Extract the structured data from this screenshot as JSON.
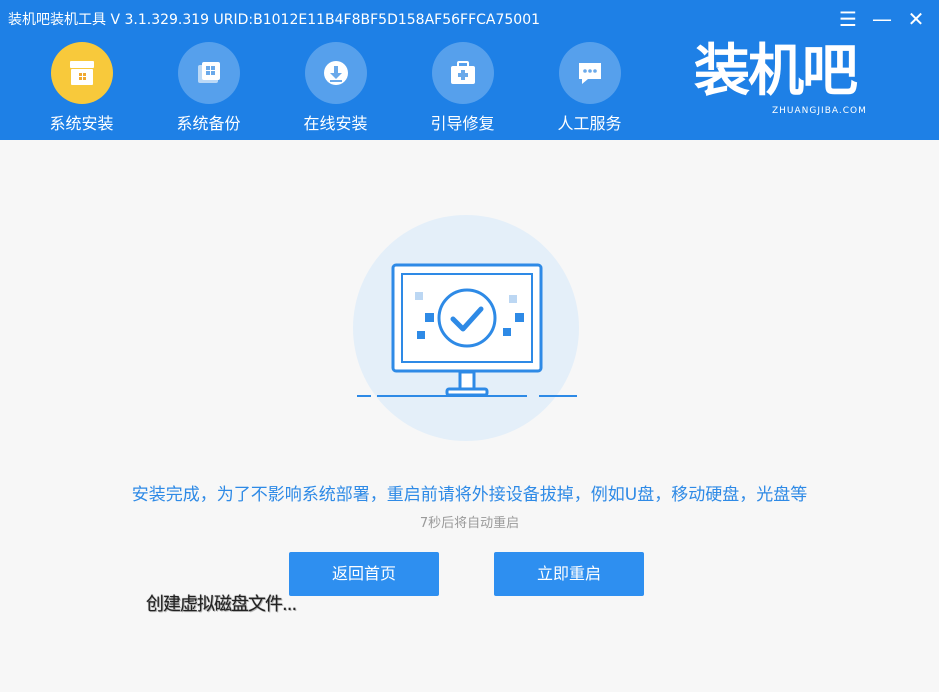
{
  "window": {
    "title": "装机吧装机工具 V 3.1.329.319 URID:B1012E11B4F8BF5D158AF56FFCA75001",
    "menu_glyph": "☰",
    "minimize_glyph": "—",
    "close_glyph": "✕"
  },
  "nav": {
    "items": [
      {
        "label": "系统安装",
        "icon": "system-install-icon",
        "active": true
      },
      {
        "label": "系统备份",
        "icon": "system-backup-icon"
      },
      {
        "label": "在线安装",
        "icon": "online-install-icon"
      },
      {
        "label": "引导修复",
        "icon": "boot-repair-icon"
      },
      {
        "label": "人工服务",
        "icon": "chat-service-icon"
      }
    ]
  },
  "brand": {
    "name_cn": "装机吧",
    "name_en": "ZHUANGJIBA.COM"
  },
  "main": {
    "message": "安装完成，为了不影响系统部署，重启前请将外接设备拔掉，例如U盘，移动硬盘，光盘等",
    "countdown": "7秒后将自动重启",
    "back_button": "返回首页",
    "restart_button": "立即重启",
    "status": "创建虚拟磁盘文件..."
  },
  "colors": {
    "header": "#1e80e6",
    "accent": "#2e8ff0",
    "active_nav": "#f8c93b"
  }
}
